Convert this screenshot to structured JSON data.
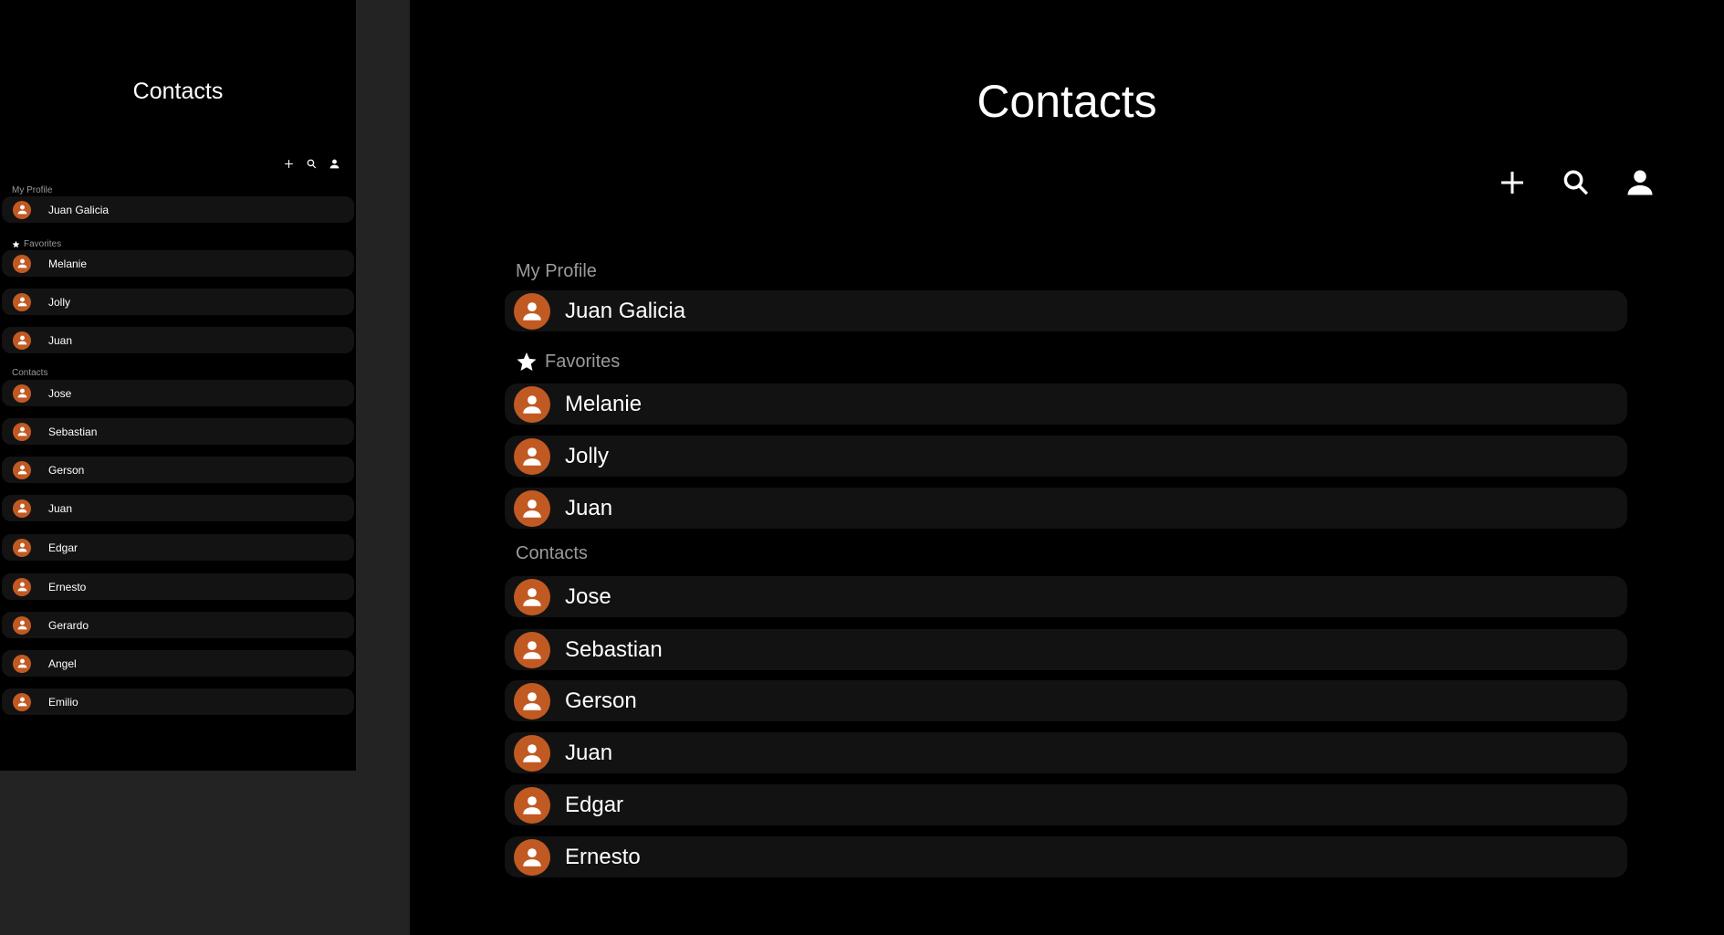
{
  "small_view": {
    "title": "Contacts",
    "toolbar": {
      "add_icon": "plus-icon",
      "search_icon": "search-icon",
      "profile_icon": "person-icon"
    },
    "my_profile": {
      "label": "My Profile",
      "name": "Juan Galicia"
    },
    "favorites": {
      "label": "Favorites",
      "items": [
        "Melanie",
        "Jolly",
        "Juan"
      ]
    },
    "contacts": {
      "label": "Contacts",
      "items": [
        "Jose",
        "Sebastian",
        "Gerson",
        "Juan",
        "Edgar",
        "Ernesto",
        "Gerardo",
        "Angel",
        "Emilio"
      ]
    }
  },
  "large_view": {
    "title": "Contacts",
    "toolbar": {
      "add_icon": "plus-icon",
      "search_icon": "search-icon",
      "profile_icon": "person-icon"
    },
    "my_profile": {
      "label": "My Profile",
      "name": "Juan Galicia"
    },
    "favorites": {
      "label": "Favorites",
      "items": [
        "Melanie",
        "Jolly",
        "Juan"
      ]
    },
    "contacts": {
      "label": "Contacts",
      "items": [
        "Jose",
        "Sebastian",
        "Gerson",
        "Juan",
        "Edgar",
        "Ernesto"
      ]
    }
  },
  "colors": {
    "background": "#000000",
    "row": "#131313",
    "avatar": "#c15a22",
    "section_label": "#9a9a9a",
    "outer": "#232323"
  }
}
